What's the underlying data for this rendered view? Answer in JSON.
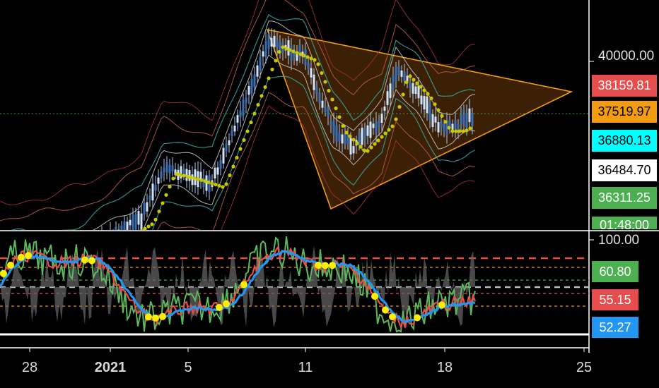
{
  "price_axis": {
    "scale_labels": [
      "40000.00",
      "100.00"
    ],
    "tags": [
      {
        "value": "38159.81",
        "bg": "#e84d4d",
        "fg": "#ffffff"
      },
      {
        "value": "37519.97",
        "bg": "#f39c12",
        "fg": "#000000"
      },
      {
        "value": "36880.13",
        "bg": "#00ffff",
        "fg": "#000000"
      },
      {
        "value": "36484.70",
        "bg": "#ffffff",
        "fg": "#000000"
      },
      {
        "value": "36311.25",
        "bg": "#4caf50",
        "fg": "#ffffff"
      },
      {
        "value": "01:48:00",
        "bg": "#4caf50",
        "fg": "#ffffff"
      }
    ]
  },
  "oscillator_axis": {
    "tags": [
      {
        "value": "60.80",
        "bg": "#4caf50",
        "fg": "#ffffff"
      },
      {
        "value": "55.15",
        "bg": "#e84d4d",
        "fg": "#ffffff"
      },
      {
        "value": "52.27",
        "bg": "#2196f3",
        "fg": "#ffffff"
      }
    ]
  },
  "time_axis": {
    "labels": [
      "28",
      "2021",
      "5",
      "11",
      "18",
      "25"
    ],
    "bold_label": "2021"
  },
  "colors": {
    "background": "#000000",
    "axis_line": "#ffffff",
    "candle": "#a8c8ee",
    "ma_yellow": "#c8c800",
    "triangle": "#f39c12",
    "triangle_fill": "#6b3a0a",
    "band_red": "#a83232",
    "band_orange": "#c0654a",
    "band_teal": "#3aa6a0",
    "band_white": "#d0d0d0",
    "osc_green": "#5cb85c",
    "osc_red": "#e84d4d",
    "osc_blue": "#2196f3",
    "osc_yellow": "#ffee00",
    "osc_gray": "#666666"
  },
  "chart_data": {
    "type": "line",
    "title": "",
    "note": "",
    "price_range": [
      34500,
      41500
    ],
    "x": [
      "28",
      "2021",
      "5",
      "11",
      "18",
      "25"
    ],
    "series": [
      {
        "values": [
          34200,
          35000,
          38600,
          41200,
          40400,
          36700,
          39800,
          37100,
          37520
        ]
      }
    ],
    "oscillator": {
      "range": [
        40,
        100
      ],
      "levels": [
        90,
        77,
        67,
        60,
        52
      ]
    }
  }
}
